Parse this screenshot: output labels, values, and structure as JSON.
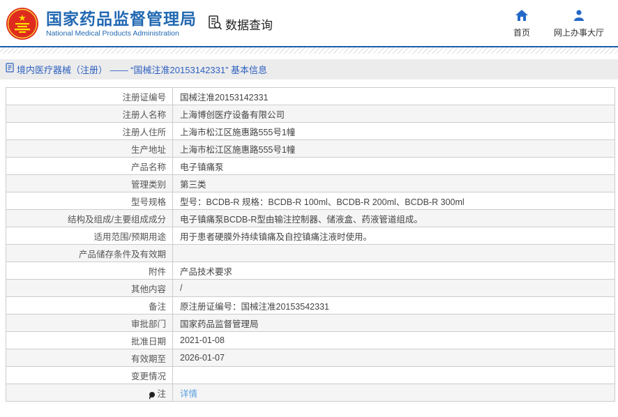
{
  "colors": {
    "brand_blue": "#2268b2",
    "nav_icon_blue": "#2468c8",
    "divider_blue": "#1a5dab",
    "breadcrumb_blue": "#2d5fc0",
    "link_blue": "#5b9fe0",
    "row_alt_gray": "#f5f5f5",
    "table_border": "#cccccc"
  },
  "header": {
    "title_cn": "国家药品监督管理局",
    "title_en": "National Medical Products Administration",
    "data_query_label": "数据查询",
    "nav": [
      {
        "label": "首页"
      },
      {
        "label": "网上办事大厅"
      }
    ]
  },
  "breadcrumb": {
    "text": "境内医疗器械（注册） —— “国械注准20153142331” 基本信息"
  },
  "table": {
    "rows": [
      {
        "label": "注册证编号",
        "value": "国械注准20153142331"
      },
      {
        "label": "注册人名称",
        "value": "上海博创医疗设备有限公司"
      },
      {
        "label": "注册人住所",
        "value": "上海市松江区施惠路555号1幢"
      },
      {
        "label": "生产地址",
        "value": "上海市松江区施惠路555号1幢"
      },
      {
        "label": "产品名称",
        "value": "电子镇痛泵"
      },
      {
        "label": "管理类别",
        "value": "第三类"
      },
      {
        "label": "型号规格",
        "value": "型号：BCDB-R 规格：BCDB-R 100ml、BCDB-R 200ml、BCDB-R 300ml"
      },
      {
        "label": "结构及组成/主要组成成分",
        "value": "电子镇痛泵BCDB-R型由输注控制器、储液盒、药液管道组成。"
      },
      {
        "label": "适用范围/预期用途",
        "value": "用于患者硬膜外持续镇痛及自控镇痛注液时使用。"
      },
      {
        "label": "产品储存条件及有效期",
        "value": ""
      },
      {
        "label": "附件",
        "value": "产品技术要求"
      },
      {
        "label": "其他内容",
        "value": "/"
      },
      {
        "label": "备注",
        "value": "原注册证编号：国械注准20153542331"
      },
      {
        "label": "审批部门",
        "value": "国家药品监督管理局"
      },
      {
        "label": "批准日期",
        "value": "2021-01-08"
      },
      {
        "label": "有效期至",
        "value": "2026-01-07"
      },
      {
        "label": "变更情况",
        "value": ""
      },
      {
        "label": "注",
        "value": "详情",
        "link": true,
        "icon": "note"
      }
    ]
  }
}
